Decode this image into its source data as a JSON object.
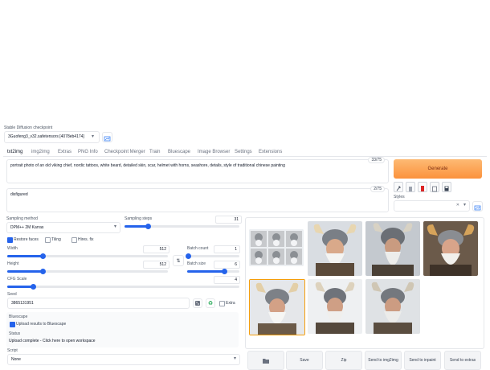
{
  "checkpoint": {
    "label": "Stable Diffusion checkpoint",
    "value": "3Guofeng3_v32.safetensors [4078eb4174]"
  },
  "tabs": [
    "txt2img",
    "img2img",
    "Extras",
    "PNG Info",
    "Checkpoint Merger",
    "Train",
    "Bluescape",
    "Image Browser",
    "Settings",
    "Extensions"
  ],
  "prompt": {
    "text": "portrait photo of an old viking chief, nordic tattoos, white beard, detailed skin, scar, helmet with horns, seashore, details, style of traditional chinese painting",
    "counter": "33/75"
  },
  "negative": {
    "text": "disfigured",
    "counter": "2/75"
  },
  "generate_label": "Generate",
  "styles_label": "Styles",
  "sampling_method": {
    "label": "Sampling method",
    "value": "DPM++ 2M Karras"
  },
  "sampling_steps": {
    "label": "Sampling steps",
    "value": "31",
    "fraction": 0.2
  },
  "restore_faces": "Restore faces",
  "tiling": "Tiling",
  "hires_fix": "Hires. fix",
  "width": {
    "label": "Width",
    "value": "512",
    "fraction": 0.22
  },
  "height": {
    "label": "Height",
    "value": "512",
    "fraction": 0.22
  },
  "batch_count": {
    "label": "Batch count",
    "value": "1",
    "fraction": 0.02
  },
  "batch_size": {
    "label": "Batch size",
    "value": "6",
    "fraction": 0.71
  },
  "cfg_scale": {
    "label": "CFG Scale",
    "value": "4",
    "fraction": 0.11
  },
  "seed": {
    "label": "Seed",
    "value": "3865131951",
    "extra": "Extra"
  },
  "bluescape": {
    "label": "Bluescape",
    "upload_label": "Upload results to Bluescape"
  },
  "status": {
    "label": "Status",
    "text": "Upload complete - Click here to open workspace"
  },
  "script": {
    "label": "Script",
    "value": "None"
  },
  "actions": [
    "Save",
    "Zip",
    "Send to img2img",
    "Send to inpaint",
    "Send to extras"
  ],
  "icons": {
    "refresh": "refresh-icon",
    "swap": "swap-icon",
    "dice": "dice-icon",
    "recycle": "recycle-icon",
    "folder": "folder-icon"
  }
}
